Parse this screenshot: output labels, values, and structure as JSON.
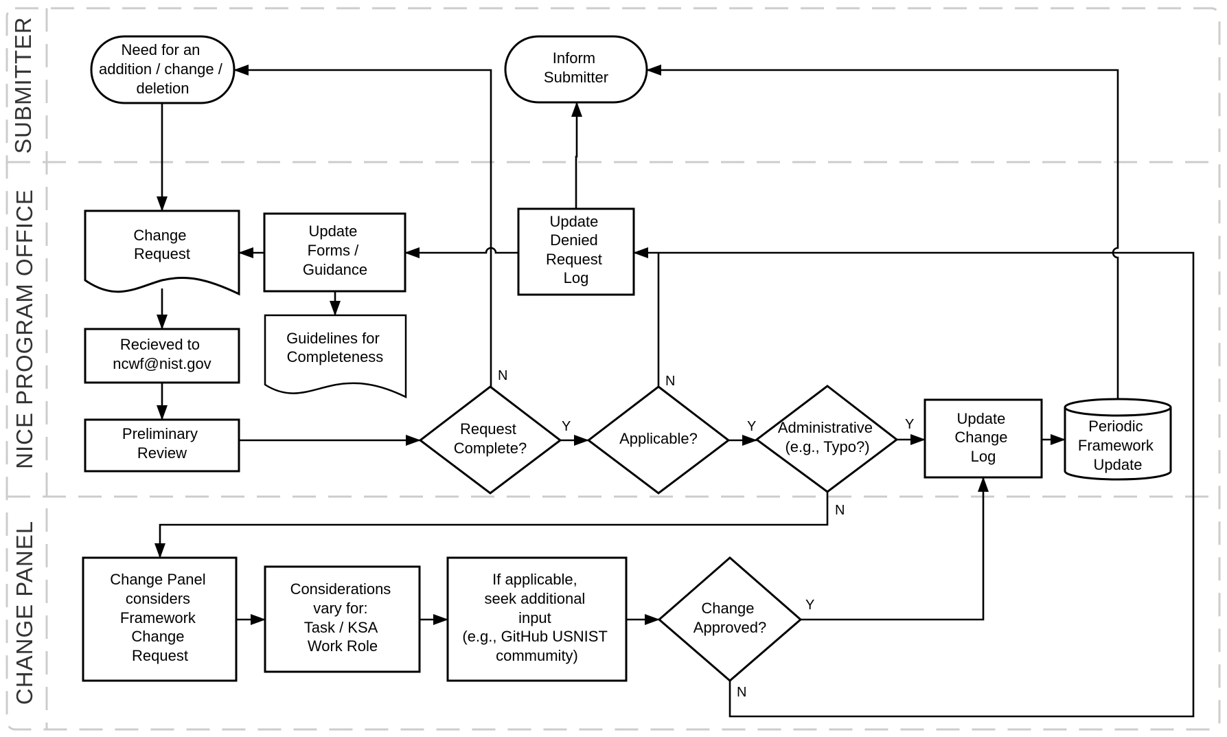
{
  "lanes": [
    {
      "id": "submitter",
      "label": "SUBMITTER"
    },
    {
      "id": "nice",
      "label": "NICE PROGRAM OFFICE"
    },
    {
      "id": "panel",
      "label": "CHANGE PANEL"
    }
  ],
  "nodes": {
    "need": {
      "type": "terminator",
      "lines": [
        "Need for an",
        "addition / change /",
        "deletion"
      ]
    },
    "inform": {
      "type": "terminator",
      "lines": [
        "Inform",
        "Submitter"
      ]
    },
    "change_request": {
      "type": "document",
      "lines": [
        "Change",
        "Request"
      ]
    },
    "update_forms": {
      "type": "process",
      "lines": [
        "Update",
        "Forms /",
        "Guidance"
      ]
    },
    "guidelines": {
      "type": "document",
      "lines": [
        "Guidelines for",
        "Completeness"
      ]
    },
    "update_denied": {
      "type": "process",
      "lines": [
        "Update",
        "Denied",
        "Request",
        "Log"
      ]
    },
    "received": {
      "type": "process",
      "lines": [
        "Recieved to",
        "ncwf@nist.gov"
      ]
    },
    "preliminary": {
      "type": "process",
      "lines": [
        "Preliminary",
        "Review"
      ]
    },
    "request_complete": {
      "type": "decision",
      "lines": [
        "Request",
        "Complete?"
      ]
    },
    "applicable": {
      "type": "decision",
      "lines": [
        "Applicable?"
      ]
    },
    "administrative": {
      "type": "decision",
      "lines": [
        "Administrative",
        "(e.g., Typo?)"
      ]
    },
    "update_change_log": {
      "type": "process",
      "lines": [
        "Update",
        "Change",
        "Log"
      ]
    },
    "periodic": {
      "type": "database",
      "lines": [
        "Periodic",
        "Framework",
        "Update"
      ]
    },
    "panel_considers": {
      "type": "process",
      "lines": [
        "Change Panel",
        "considers",
        "Framework",
        "Change",
        "Request"
      ]
    },
    "considerations": {
      "type": "process",
      "lines": [
        "Considerations",
        "vary for:",
        "Task / KSA",
        "Work Role"
      ]
    },
    "seek_input": {
      "type": "process",
      "lines": [
        "If applicable,",
        "seek additional",
        "input",
        "(e.g., GitHub USNIST",
        "commumity)"
      ]
    },
    "change_approved": {
      "type": "decision",
      "lines": [
        "Change",
        "Approved?"
      ]
    }
  },
  "edge_labels": {
    "rc_no": "N",
    "rc_yes": "Y",
    "app_no": "N",
    "app_yes": "Y",
    "admin_yes": "Y",
    "admin_no": "N",
    "approved_yes": "Y",
    "approved_no": "N"
  }
}
